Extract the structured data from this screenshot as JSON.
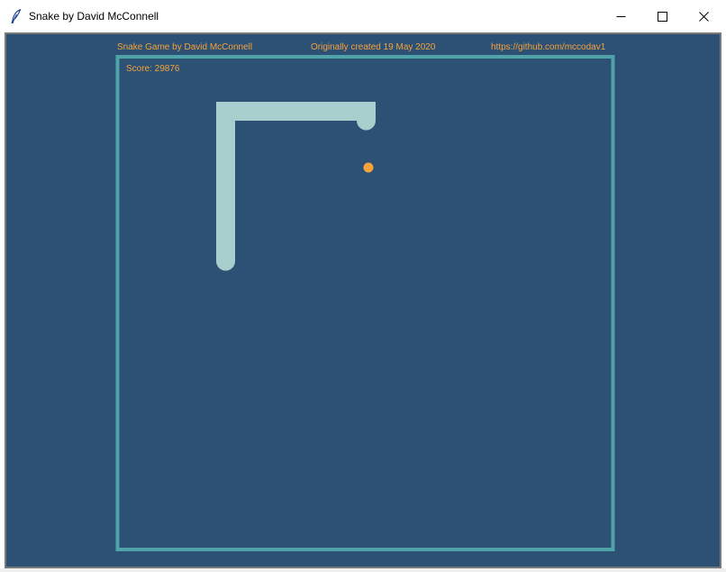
{
  "window": {
    "title": "Snake by David McConnell",
    "icon": "feather-icon",
    "controls": [
      "minimize-icon",
      "maximize-icon",
      "close-icon"
    ]
  },
  "header": {
    "left": "Snake Game by David McConnell",
    "center": "Originally created 19 May 2020",
    "right": "https://github.com/mccodav1"
  },
  "game": {
    "score_label": "Score: 29876",
    "colors": {
      "background": "#2d5075",
      "border": "#4fa3a9",
      "snake": "#a9cece",
      "food": "#f5a33a",
      "text": "#f5a33a"
    }
  }
}
